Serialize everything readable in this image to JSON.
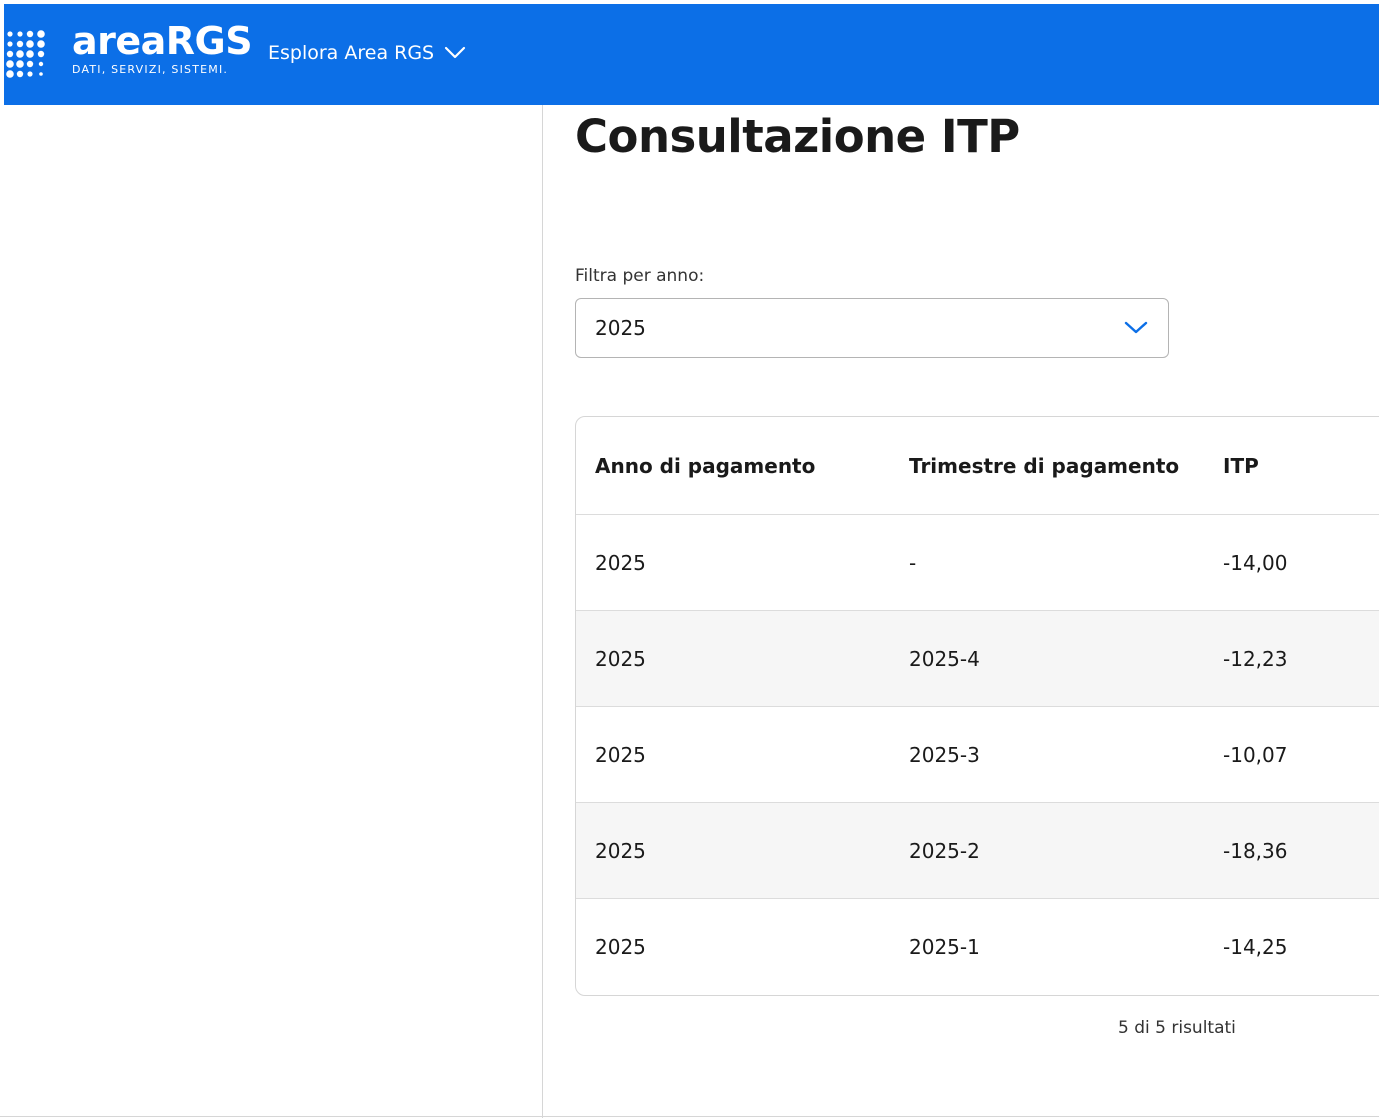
{
  "header": {
    "logo_word": "areaRGS",
    "logo_tagline": "DATI, SERVIZI, SISTEMI.",
    "nav_label": "Esplora Area RGS",
    "brand_color": "#0c6fe7"
  },
  "main": {
    "title": "Consultazione ITP",
    "filter": {
      "label": "Filtra per anno:",
      "selected": "2025"
    },
    "table": {
      "columns": [
        "Anno di pagamento",
        "Trimestre di pagamento",
        "ITP"
      ],
      "rows": [
        [
          "2025",
          "-",
          "-14,00"
        ],
        [
          "2025",
          "2025-4",
          "-12,23"
        ],
        [
          "2025",
          "2025-3",
          "-10,07"
        ],
        [
          "2025",
          "2025-2",
          "-18,36"
        ],
        [
          "2025",
          "2025-1",
          "-14,25"
        ]
      ]
    },
    "results_text": "5 di 5 risultati"
  },
  "icons": [
    "logo-dots-icon",
    "chevron-down-icon",
    "select-chevron-icon"
  ]
}
